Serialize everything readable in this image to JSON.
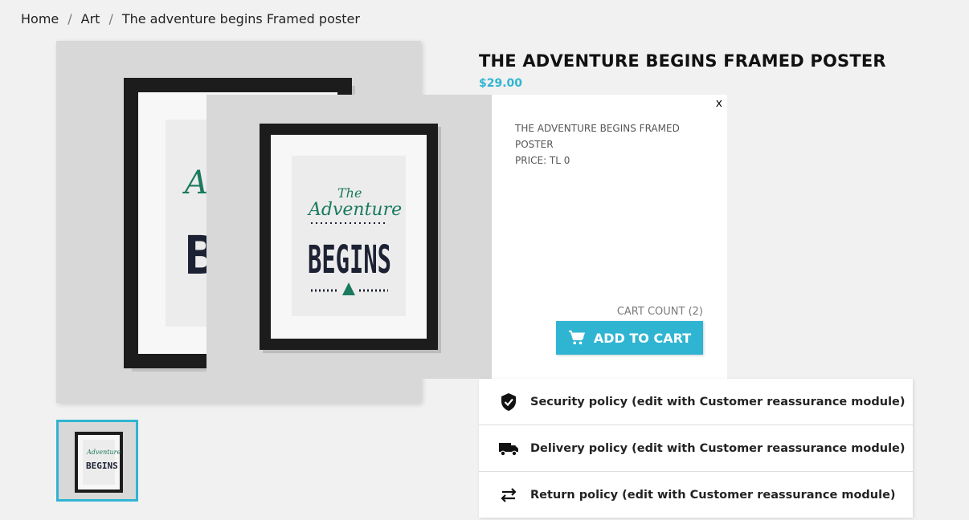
{
  "breadcrumb": {
    "items": [
      "Home",
      "Art",
      "The adventure begins Framed poster"
    ],
    "separator": "/"
  },
  "product": {
    "title": "THE ADVENTURE BEGINS FRAMED POSTER",
    "price": "$29.00"
  },
  "poster": {
    "word1": "The",
    "word2": "Adventure",
    "word3": "BEGINS"
  },
  "popup": {
    "close": "x",
    "name": "THE ADVENTURE BEGINS FRAMED POSTER",
    "price": "PRICE: TL 0",
    "cart_count": "CART COUNT (2)",
    "add_to_cart": "ADD TO CART"
  },
  "reassurance": [
    {
      "icon": "shield-check-icon",
      "label": "Security policy (edit with Customer reassurance module)"
    },
    {
      "icon": "truck-icon",
      "label": "Delivery policy (edit with Customer reassurance module)"
    },
    {
      "icon": "swap-arrows-icon",
      "label": "Return policy (edit with Customer reassurance module)"
    }
  ],
  "colors": {
    "accent": "#2fb5d2",
    "poster_green": "#1a7a5e",
    "poster_navy": "#1c2233"
  }
}
